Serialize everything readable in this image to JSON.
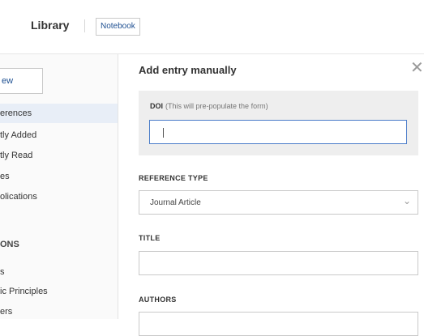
{
  "header": {
    "brand": "Library",
    "notebook_tab": "Notebook"
  },
  "sidebar": {
    "new_button": "ew",
    "items": [
      {
        "label": "erences"
      },
      {
        "label": "tly Added"
      },
      {
        "label": "tly Read"
      },
      {
        "label": "es"
      },
      {
        "label": "olications"
      }
    ],
    "section_heading": "ONS",
    "group_items": [
      {
        "label": "s"
      },
      {
        "label": "ic Principles"
      },
      {
        "label": "ers"
      }
    ]
  },
  "dialog": {
    "title": "Add entry manually",
    "close_icon": "close-icon",
    "doi": {
      "label": "DOI",
      "hint": "(This will pre-populate the form)",
      "value": ""
    },
    "reference_type": {
      "label": "REFERENCE TYPE",
      "selected": "Journal Article",
      "chevron_icon": "chevron-down-icon"
    },
    "title_field": {
      "label": "TITLE",
      "value": ""
    },
    "authors_field": {
      "label": "AUTHORS",
      "value": ""
    }
  },
  "colors": {
    "accent": "#1d4f91",
    "focus_border": "#4a7cc9",
    "selected_bg": "#e8eef7"
  }
}
